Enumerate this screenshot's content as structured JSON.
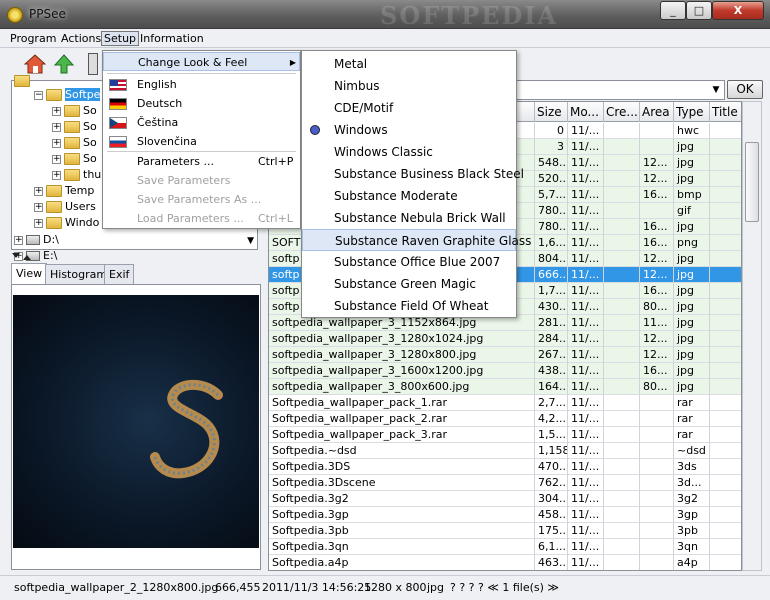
{
  "app": {
    "title": "PPSee",
    "watermark": "SOFTPEDIA",
    "window_controls": [
      "_",
      "□",
      "X"
    ]
  },
  "menubar": [
    "Program",
    "Actions",
    "Setup",
    "Information"
  ],
  "tree": {
    "items": [
      {
        "label": "Softpe",
        "level": 1,
        "selected": true
      },
      {
        "label": "So",
        "level": 2
      },
      {
        "label": "So",
        "level": 2
      },
      {
        "label": "So",
        "level": 2
      },
      {
        "label": "So",
        "level": 2
      },
      {
        "label": "thu",
        "level": 2
      },
      {
        "label": "Temp",
        "level": 1
      },
      {
        "label": "Users",
        "level": 1
      },
      {
        "label": "Windo",
        "level": 1
      },
      {
        "label": "D:\\",
        "level": 0
      },
      {
        "label": "E:\\",
        "level": 0
      }
    ]
  },
  "tabs": [
    "View",
    "Histogram",
    "Exif"
  ],
  "address": {
    "ok_label": "OK"
  },
  "grid": {
    "columns": [
      "Size",
      "Mo...",
      "Cre...",
      "Area",
      "Type",
      "Title"
    ],
    "rows": [
      {
        "name": "",
        "size": "0",
        "mod": "11/...",
        "cre": "",
        "area": "",
        "type": "hwc",
        "green": false
      },
      {
        "name": "",
        "size": "3",
        "mod": "11/...",
        "cre": "",
        "area": "",
        "type": "jpg",
        "green": true
      },
      {
        "name": "",
        "size": "548...",
        "mod": "11/...",
        "cre": "",
        "area": "12...",
        "type": "jpg",
        "green": true
      },
      {
        "name": "",
        "size": "520...",
        "mod": "11/...",
        "cre": "",
        "area": "12...",
        "type": "jpg",
        "green": true
      },
      {
        "name": "",
        "size": "5,7...",
        "mod": "11/...",
        "cre": "",
        "area": "16...",
        "type": "bmp",
        "green": true
      },
      {
        "name": "",
        "size": "780...",
        "mod": "11/...",
        "cre": "",
        "area": "",
        "type": "gif",
        "green": true
      },
      {
        "name": "",
        "size": "780...",
        "mod": "11/...",
        "cre": "",
        "area": "16...",
        "type": "jpg",
        "green": true
      },
      {
        "name": "SOFT",
        "size": "1,6...",
        "mod": "11/...",
        "cre": "",
        "area": "16...",
        "type": "png",
        "green": true
      },
      {
        "name": "softp",
        "size": "804...",
        "mod": "11/...",
        "cre": "",
        "area": "12...",
        "type": "jpg",
        "green": true
      },
      {
        "name": "softp",
        "size": "666...",
        "mod": "11/...",
        "cre": "",
        "area": "12...",
        "type": "jpg",
        "green": false,
        "selected": true
      },
      {
        "name": "softp",
        "size": "1,7...",
        "mod": "11/...",
        "cre": "",
        "area": "16...",
        "type": "jpg",
        "green": true
      },
      {
        "name": "softp",
        "size": "430...",
        "mod": "11/...",
        "cre": "",
        "area": "80...",
        "type": "jpg",
        "green": true
      },
      {
        "name": "softpedia_wallpaper_3_1152x864.jpg",
        "size": "281...",
        "mod": "11/...",
        "cre": "",
        "area": "11...",
        "type": "jpg",
        "green": true
      },
      {
        "name": "softpedia_wallpaper_3_1280x1024.jpg",
        "size": "284...",
        "mod": "11/...",
        "cre": "",
        "area": "12...",
        "type": "jpg",
        "green": true
      },
      {
        "name": "softpedia_wallpaper_3_1280x800.jpg",
        "size": "267...",
        "mod": "11/...",
        "cre": "",
        "area": "12...",
        "type": "jpg",
        "green": true
      },
      {
        "name": "softpedia_wallpaper_3_1600x1200.jpg",
        "size": "438...",
        "mod": "11/...",
        "cre": "",
        "area": "16...",
        "type": "jpg",
        "green": true
      },
      {
        "name": "softpedia_wallpaper_3_800x600.jpg",
        "size": "164...",
        "mod": "11/...",
        "cre": "",
        "area": "80...",
        "type": "jpg",
        "green": true
      },
      {
        "name": "Softpedia_wallpaper_pack_1.rar",
        "size": "2,7...",
        "mod": "11/...",
        "cre": "",
        "area": "",
        "type": "rar",
        "green": false
      },
      {
        "name": "Softpedia_wallpaper_pack_2.rar",
        "size": "4,2...",
        "mod": "11/...",
        "cre": "",
        "area": "",
        "type": "rar",
        "green": false
      },
      {
        "name": "Softpedia_wallpaper_pack_3.rar",
        "size": "1,5...",
        "mod": "11/...",
        "cre": "",
        "area": "",
        "type": "rar",
        "green": false
      },
      {
        "name": "Softpedia.~dsd",
        "size": "1,158",
        "mod": "11/...",
        "cre": "",
        "area": "",
        "type": "~dsd",
        "green": false
      },
      {
        "name": "Softpedia.3DS",
        "size": "470...",
        "mod": "11/...",
        "cre": "",
        "area": "",
        "type": "3ds",
        "green": false
      },
      {
        "name": "Softpedia.3Dscene",
        "size": "762...",
        "mod": "11/...",
        "cre": "",
        "area": "",
        "type": "3d...",
        "green": false
      },
      {
        "name": "Softpedia.3g2",
        "size": "304...",
        "mod": "11/...",
        "cre": "",
        "area": "",
        "type": "3g2",
        "green": false
      },
      {
        "name": "Softpedia.3gp",
        "size": "458...",
        "mod": "11/...",
        "cre": "",
        "area": "",
        "type": "3gp",
        "green": false
      },
      {
        "name": "Softpedia.3pb",
        "size": "175...",
        "mod": "11/...",
        "cre": "",
        "area": "",
        "type": "3pb",
        "green": false
      },
      {
        "name": "Softpedia.3qn",
        "size": "6,1...",
        "mod": "11/...",
        "cre": "",
        "area": "",
        "type": "3qn",
        "green": false
      },
      {
        "name": "Softpedia.a4p",
        "size": "463...",
        "mod": "11/...",
        "cre": "",
        "area": "",
        "type": "a4p",
        "green": false
      }
    ]
  },
  "setup_menu": {
    "items": [
      {
        "label": "Change Look & Feel",
        "shortcut": "",
        "disabled": false,
        "submenu": true,
        "hot": true
      },
      {
        "label": "English",
        "flag": "en"
      },
      {
        "label": "Deutsch",
        "flag": "de"
      },
      {
        "label": "Čeština",
        "flag": "cz"
      },
      {
        "label": "Slovenčina",
        "flag": "sk"
      },
      {
        "label": "Parameters ...",
        "shortcut": "Ctrl+P",
        "disabled": false
      },
      {
        "label": "Save Parameters",
        "shortcut": "",
        "disabled": true
      },
      {
        "label": "Save Parameters As ...",
        "shortcut": "",
        "disabled": true
      },
      {
        "label": "Load Parameters ...",
        "shortcut": "Ctrl+L",
        "disabled": true
      }
    ]
  },
  "look_feel_menu": {
    "items": [
      {
        "label": "Metal"
      },
      {
        "label": "Nimbus"
      },
      {
        "label": "CDE/Motif"
      },
      {
        "label": "Windows",
        "checked": true
      },
      {
        "label": "Windows Classic"
      },
      {
        "label": "Substance Business Black Steel"
      },
      {
        "label": "Substance Moderate"
      },
      {
        "label": "Substance Nebula Brick Wall"
      },
      {
        "label": "Substance Raven Graphite Glass",
        "hot": true
      },
      {
        "label": "Substance Office Blue 2007"
      },
      {
        "label": "Substance Green Magic"
      },
      {
        "label": "Substance Field Of Wheat"
      }
    ]
  },
  "status": {
    "file": "softpedia_wallpaper_2_1280x800.jpg",
    "size": "666,455",
    "date": "2011/11/3 14:56:25",
    "dims": "1280 x 800",
    "type": "jpg",
    "extra": "? ? ? ? ≪ 1 file(s) ≫"
  },
  "colors": {
    "selection": "#3296e6",
    "green_row": "#eaf6e8"
  }
}
